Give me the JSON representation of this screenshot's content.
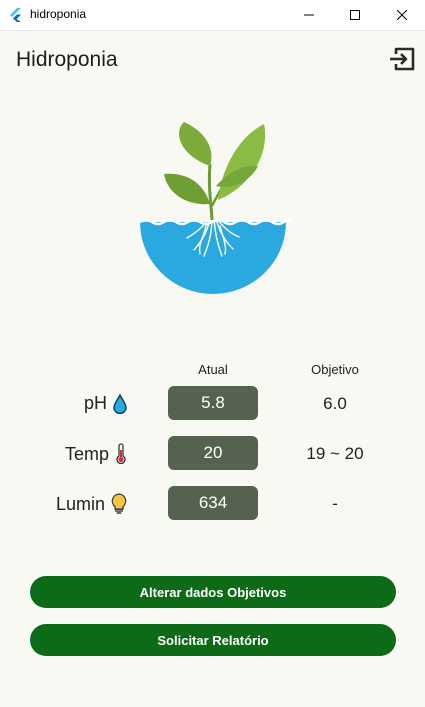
{
  "window": {
    "title": "hidroponia"
  },
  "appbar": {
    "title": "Hidroponia",
    "logout_icon": "logout-icon"
  },
  "table": {
    "headers": {
      "current": "Atual",
      "target": "Objetivo"
    },
    "rows": [
      {
        "label": "pH",
        "icon": "water-drop-icon",
        "current": "5.8",
        "target": "6.0"
      },
      {
        "label": "Temp",
        "icon": "thermometer-icon",
        "current": "20",
        "target": "19 ~ 20"
      },
      {
        "label": "Lumin",
        "icon": "lightbulb-icon",
        "current": "634",
        "target": "-"
      }
    ]
  },
  "buttons": {
    "change_targets": "Alterar dados Objetivos",
    "request_report": "Solicitar Relatório"
  },
  "colors": {
    "background": "#f9f9f3",
    "value_box": "#55624f",
    "button": "#0d6b17",
    "water": "#2aa8e0",
    "leaf": "#7cab3c"
  }
}
